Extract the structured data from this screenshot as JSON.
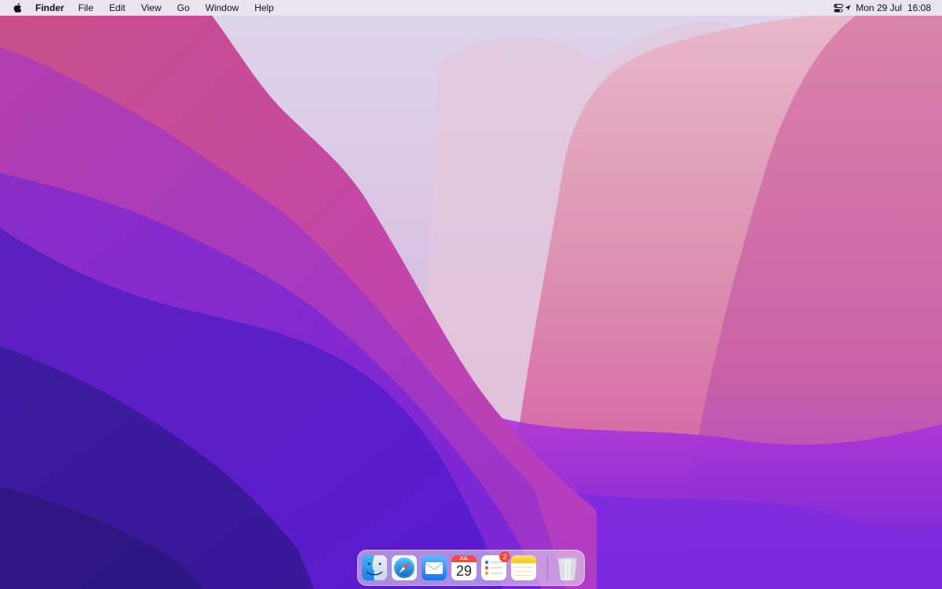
{
  "menubar": {
    "apple_icon": "apple-logo-icon",
    "app_name": "Finder",
    "menus": [
      "File",
      "Edit",
      "View",
      "Go",
      "Window",
      "Help"
    ],
    "control_center_icon": "control-center-icon",
    "location_icon": "location-arrow-icon",
    "date": "Mon 29 Jul",
    "time": "16:08"
  },
  "dock": {
    "items": [
      {
        "name": "finder",
        "icon": "finder-icon"
      },
      {
        "name": "safari",
        "icon": "safari-compass-icon"
      },
      {
        "name": "mail",
        "icon": "mail-envelope-icon"
      },
      {
        "name": "calendar",
        "icon": "calendar-icon",
        "month": "JUL",
        "day": "29"
      },
      {
        "name": "reminders",
        "icon": "reminders-list-icon",
        "badge": "2"
      },
      {
        "name": "notes",
        "icon": "notes-icon"
      },
      {
        "name": "trash",
        "icon": "trash-icon"
      }
    ]
  },
  "wallpaper": {
    "palette": {
      "deep_violet": "#3a1a9a",
      "purple": "#7a26d8",
      "magenta": "#c0449e",
      "pink": "#e88aa8",
      "mist": "#ded4ea"
    }
  }
}
